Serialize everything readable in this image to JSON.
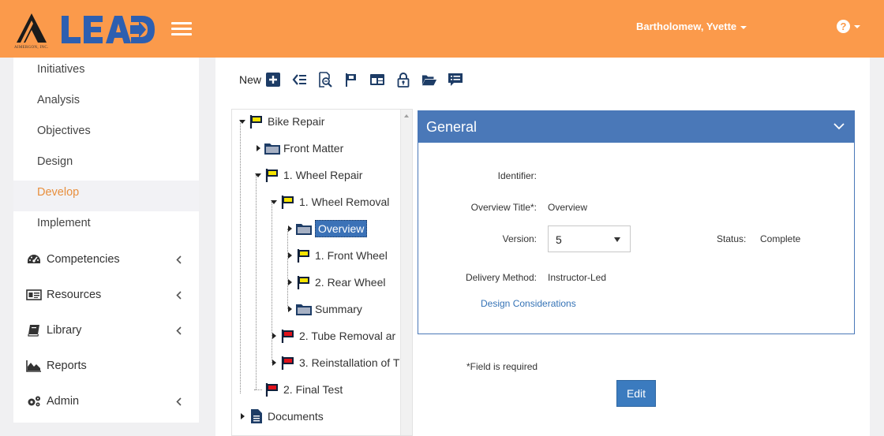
{
  "header": {
    "logo_text": "LEAD",
    "logo_subtext": "AIMERGON, INC.",
    "user_name": "Bartholomew, Yvette",
    "help_glyph": "?",
    "bg_color": "#fb9a4b"
  },
  "sidebar": {
    "items": [
      {
        "label": "Initiatives"
      },
      {
        "label": "Analysis"
      },
      {
        "label": "Objectives"
      },
      {
        "label": "Design"
      },
      {
        "label": "Develop",
        "active": true
      },
      {
        "label": "Implement"
      }
    ],
    "groups": [
      {
        "label": "Competencies",
        "icon": "dashboard-icon"
      },
      {
        "label": "Resources",
        "icon": "id-card-icon"
      },
      {
        "label": "Library",
        "icon": "book-icon"
      },
      {
        "label": "Reports",
        "icon": "area-chart-icon"
      },
      {
        "label": "Admin",
        "icon": "gears-icon"
      }
    ]
  },
  "toolbar": {
    "new_label": "New",
    "buttons": [
      "add-icon",
      "reorder-icon",
      "preview-icon",
      "flag-icon",
      "layout-icon",
      "lock-icon",
      "folder-open-icon",
      "list-icon"
    ]
  },
  "tree": {
    "nodes": [
      {
        "label": "Bike Repair",
        "icon": "yellow-flag-icon",
        "expanded": true
      },
      {
        "label": "Front Matter",
        "icon": "folder-icon",
        "expanded": false
      },
      {
        "label": "1. Wheel Repair",
        "icon": "yellow-flag-icon",
        "expanded": true
      },
      {
        "label": "1. Wheel Removal",
        "icon": "yellow-flag-icon",
        "expanded": true
      },
      {
        "label": "Overview",
        "icon": "folder-icon",
        "expanded": false,
        "selected": true
      },
      {
        "label": "1. Front Wheel",
        "icon": "yellow-flag-icon",
        "expanded": false
      },
      {
        "label": "2. Rear Wheel",
        "icon": "yellow-flag-icon",
        "expanded": false
      },
      {
        "label": "Summary",
        "icon": "folder-icon",
        "expanded": false
      },
      {
        "label": "2. Tube Removal ar",
        "icon": "red-flag-icon",
        "expanded": false
      },
      {
        "label": "3. Reinstallation of T",
        "icon": "red-flag-icon",
        "expanded": false
      },
      {
        "label": "2. Final Test",
        "icon": "red-flag-icon",
        "expanded": null
      },
      {
        "label": "Documents",
        "icon": "document-icon",
        "expanded": false
      }
    ]
  },
  "panel": {
    "title": "General",
    "identifier_label": "Identifier:",
    "identifier_value": "",
    "overview_title_label": "Overview Title*:",
    "overview_title_value": "Overview",
    "version_label": "Version:",
    "version_value": "5",
    "status_label": "Status:",
    "status_value": "Complete",
    "delivery_label": "Delivery Method:",
    "delivery_value": "Instructor-Led",
    "design_link": "Design Considerations"
  },
  "footer": {
    "required_note": "*Field is required",
    "edit_label": "Edit"
  },
  "colors": {
    "accent": "#fb9a4b",
    "primary": "#4a78b8",
    "active_nav": "#e88f3d",
    "flag_yellow": "#f5e400",
    "flag_red": "#e0121b",
    "folder": "#8e9db5"
  }
}
